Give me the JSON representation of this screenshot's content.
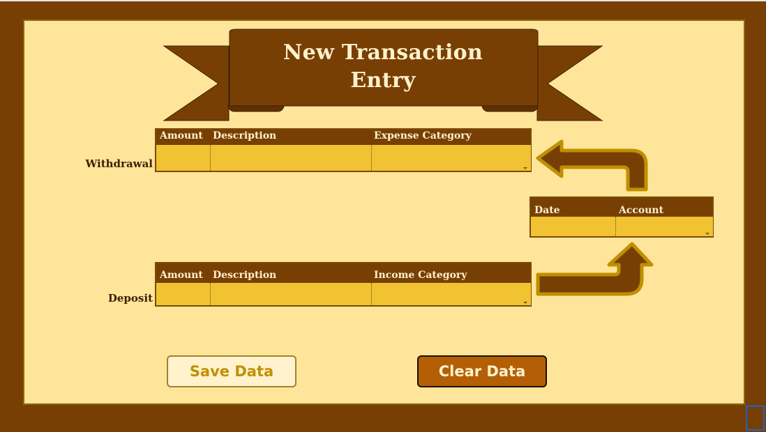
{
  "title": {
    "line1": "New Transaction",
    "line2": "Entry"
  },
  "withdrawal": {
    "label": "Withdrawal",
    "headers": {
      "amount": "Amount",
      "description": "Description",
      "category": "Expense Category"
    },
    "values": {
      "amount": "",
      "description": "",
      "category": ""
    }
  },
  "deposit": {
    "label": "Deposit",
    "headers": {
      "amount": "Amount",
      "description": "Description",
      "category": "Income Category"
    },
    "values": {
      "amount": "",
      "description": "",
      "category": ""
    }
  },
  "shared": {
    "headers": {
      "date": "Date",
      "account": "Account"
    },
    "values": {
      "date": "",
      "account": ""
    }
  },
  "buttons": {
    "save": "Save Data",
    "clear": "Clear Data"
  },
  "icons": {
    "withdrawal_arrow": "arrow-up-left-icon",
    "deposit_arrow": "arrow-right-up-icon",
    "dropdown": "chevron-down-icon"
  },
  "colors": {
    "frame": "#783f04",
    "panel": "#ffe599",
    "input": "#f1c232",
    "header": "#783f04",
    "header_text": "#fff2cc",
    "arrow": "#783f04",
    "arrow_outline": "#bf9000",
    "save_button_bg": "#fff2cc",
    "save_button_text": "#bf9000",
    "clear_button_bg": "#b45f06",
    "clear_button_text": "#fff2cc"
  }
}
